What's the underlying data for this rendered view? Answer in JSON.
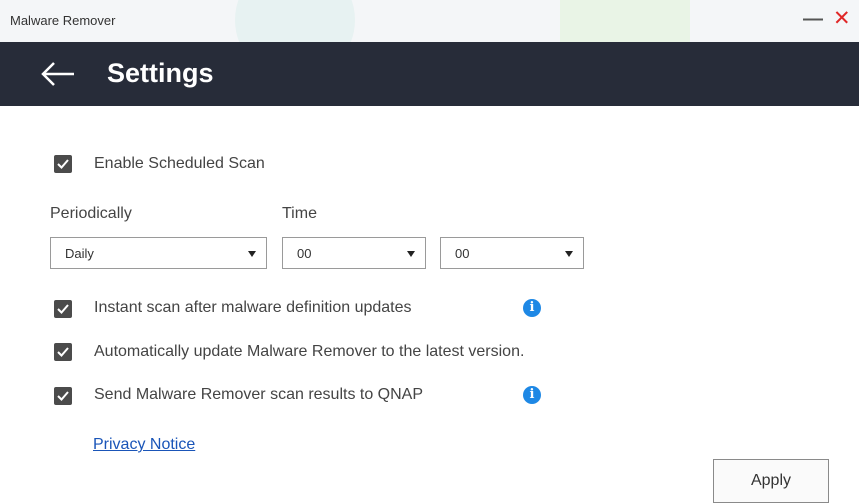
{
  "window": {
    "title": "Malware Remover",
    "minimize_glyph": "—",
    "close_glyph": "✕"
  },
  "header": {
    "title": "Settings",
    "back_icon": "arrow-left-icon"
  },
  "settings": {
    "enable_scheduled_scan": {
      "label": "Enable Scheduled Scan",
      "checked": true
    },
    "periodically": {
      "label": "Periodically",
      "value": "Daily"
    },
    "time": {
      "label": "Time",
      "hour": "00",
      "minute": "00"
    },
    "instant_scan": {
      "label": "Instant scan after malware definition updates",
      "checked": true
    },
    "auto_update": {
      "label": "Automatically update Malware Remover to the latest version.",
      "checked": true
    },
    "send_results": {
      "label": "Send Malware Remover scan results to QNAP",
      "checked": true
    },
    "info_glyph": "i"
  },
  "privacy_link": "Privacy Notice",
  "apply_label": "Apply",
  "colors": {
    "header_bg": "#272c39",
    "close_red": "#e02727",
    "info_blue": "#1e88e5",
    "link_blue": "#1a55b8",
    "checkbox": "#4b4b4b"
  }
}
